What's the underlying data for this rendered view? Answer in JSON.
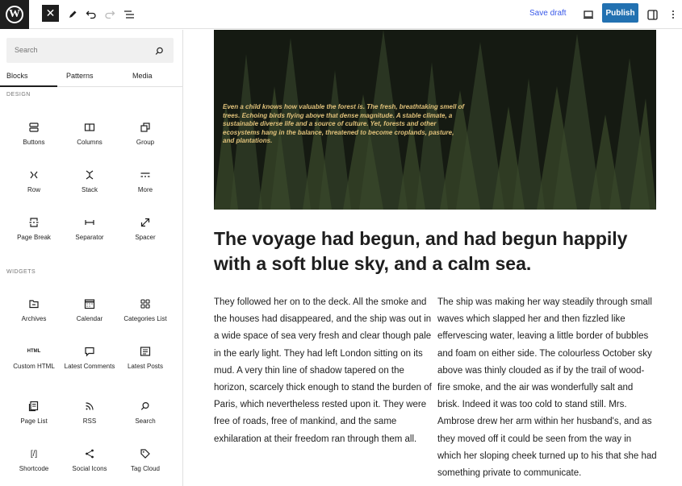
{
  "topbar": {
    "logo_letter": "W",
    "close_icon": "close-icon",
    "save_draft": "Save draft",
    "publish": "Publish"
  },
  "sidebar": {
    "search_placeholder": "Search",
    "tabs": [
      "Blocks",
      "Patterns",
      "Media"
    ],
    "categories": {
      "design": "DESIGN",
      "widgets": "WIDGETS"
    },
    "design_blocks": [
      "Buttons",
      "Columns",
      "Group",
      "Row",
      "Stack",
      "More",
      "Page Break",
      "Separator",
      "Spacer"
    ],
    "widget_blocks": [
      "Archives",
      "Calendar",
      "Categories List",
      "Custom HTML",
      "Latest Comments",
      "Latest Posts",
      "Page List",
      "RSS",
      "Search",
      "Shortcode",
      "Social Icons",
      "Tag Cloud"
    ],
    "html_glyph": "HTML",
    "shortcode_glyph": "[/]"
  },
  "content": {
    "cover_quote": "Even a child knows how valuable the forest is. The fresh, breathtaking smell of trees. Echoing birds flying above that dense magnitude. A stable climate, a sustainable diverse life and a source of culture. Yet, forests and other ecosystems hang in the balance, threatened to become croplands, pasture, and plantations.",
    "heading": "The voyage had begun, and had begun happily with a soft blue sky, and a calm sea.",
    "col1": "They followed her on to the deck. All the smoke and the houses had disappeared, and the ship was out in a wide space of sea very fresh and clear though pale in the early light. They had left London sitting on its mud. A very thin line of shadow tapered on the horizon, scarcely thick enough to stand the burden of Paris, which nevertheless rested upon it. They were free of roads, free of mankind, and the same exhilaration at their freedom ran through them all.",
    "col2": "The ship was making her way steadily through small waves which slapped her and then fizzled like effervescing water, leaving a little border of bubbles and foam on either side. The colourless October sky above was thinly clouded as if by the trail of wood-fire smoke, and the air was wonderfully salt and brisk. Indeed it was too cold to stand still. Mrs. Ambrose drew her arm within her husband's, and as they moved off it could be seen from the way in which her sloping cheek turned up to his that she had something private to communicate."
  }
}
